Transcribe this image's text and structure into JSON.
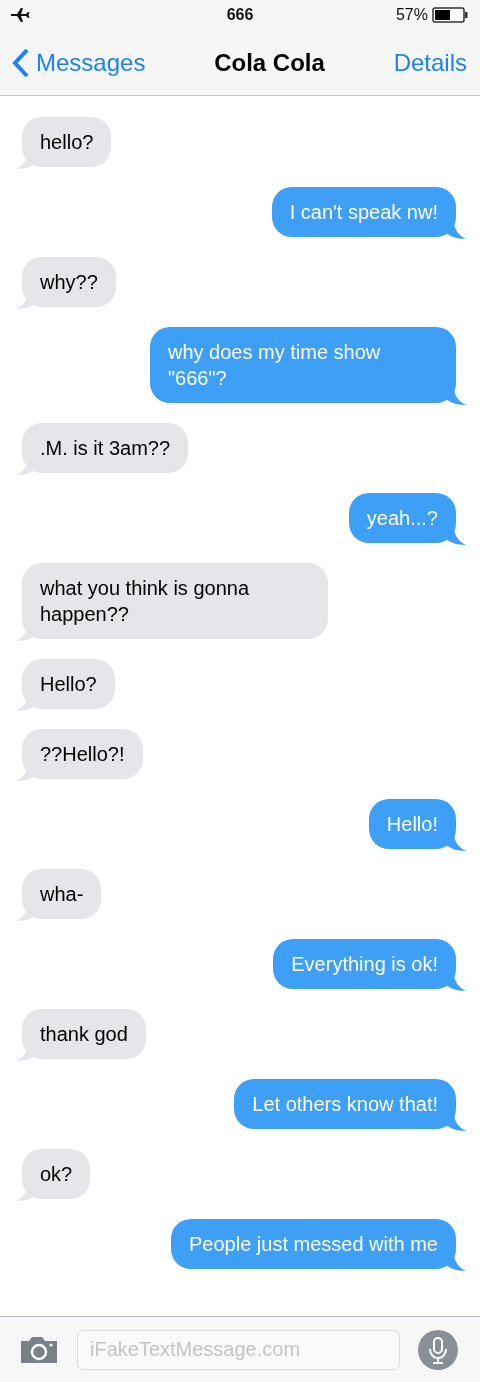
{
  "status_bar": {
    "time": "666",
    "battery": "57%"
  },
  "nav": {
    "back": "Messages",
    "title": "Cola Cola",
    "action": "Details"
  },
  "messages": [
    {
      "kind": "incoming",
      "text": "hello?"
    },
    {
      "kind": "outgoing",
      "text": "I can't speak nw!"
    },
    {
      "kind": "incoming",
      "text": "why??"
    },
    {
      "kind": "outgoing",
      "text": "why does my time show \"666\"?"
    },
    {
      "kind": "incoming",
      "text": ".M. is it 3am??"
    },
    {
      "kind": "outgoing",
      "text": "yeah...?"
    },
    {
      "kind": "incoming",
      "text": "what you think is gonna happen??"
    },
    {
      "kind": "incoming",
      "text": "Hello?"
    },
    {
      "kind": "incoming",
      "text": "??Hello?!"
    },
    {
      "kind": "outgoing",
      "text": "Hello!"
    },
    {
      "kind": "incoming",
      "text": "wha-"
    },
    {
      "kind": "outgoing",
      "text": "Everything is ok!"
    },
    {
      "kind": "incoming",
      "text": "thank god"
    },
    {
      "kind": "outgoing",
      "text": "Let others know that!"
    },
    {
      "kind": "incoming",
      "text": "ok?"
    },
    {
      "kind": "outgoing",
      "text": "People just messed with me"
    }
  ],
  "composer": {
    "placeholder": "iFakeTextMessage.com"
  }
}
